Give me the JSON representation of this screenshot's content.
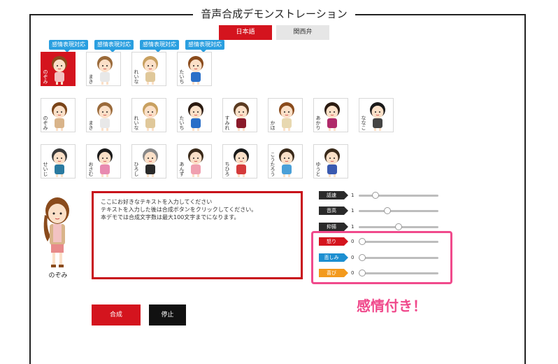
{
  "title": "音声合成デモンストレーション",
  "lang_tabs": [
    "日本語",
    "関西弁"
  ],
  "emotion_badge": "感情表現対応",
  "row1": [
    {
      "name": "のぞみ",
      "hair": "#8a4b1c",
      "shirt": "#f2c2c2"
    },
    {
      "name": "まき",
      "hair": "#9a6a3a",
      "shirt": "#e8e8e8"
    },
    {
      "name": "れいな",
      "hair": "#c8a060",
      "shirt": "#e0c89a"
    },
    {
      "name": "たいち",
      "hair": "#8a4b1c",
      "shirt": "#2a6fc8"
    }
  ],
  "row2": [
    {
      "name": "のぞみ",
      "hair": "#7a4418",
      "shirt": "#d9b48a"
    },
    {
      "name": "まき",
      "hair": "#9a6a3a",
      "shirt": "#e8e8e8"
    },
    {
      "name": "れいな",
      "hair": "#c8a060",
      "shirt": "#e0c89a"
    },
    {
      "name": "たいち",
      "hair": "#2a1a10",
      "shirt": "#2a6fc8"
    },
    {
      "name": "すみれ",
      "hair": "#5a3a20",
      "shirt": "#8a1a2a"
    },
    {
      "name": "かほ",
      "hair": "#8a4b1c",
      "shirt": "#e8d8b0"
    },
    {
      "name": "あかり",
      "hair": "#2a1a10",
      "shirt": "#b02a6a"
    },
    {
      "name": "ななこ",
      "hair": "#1a1a1a",
      "shirt": "#444444"
    }
  ],
  "row3": [
    {
      "name": "せいじ",
      "hair": "#3a3a3a",
      "shirt": "#2a7aa0"
    },
    {
      "name": "おさむ",
      "hair": "#1a1a1a",
      "shirt": "#e88ab0"
    },
    {
      "name": "ひろし",
      "hair": "#888888",
      "shirt": "#2a2a2a"
    },
    {
      "name": "あんず",
      "hair": "#3a2a1a",
      "shirt": "#f0a0b0"
    },
    {
      "name": "ちひろ",
      "hair": "#1a1a1a",
      "shirt": "#d43a3a"
    },
    {
      "name": "こうたろう",
      "hair": "#3a2a1a",
      "shirt": "#4aa0d8"
    },
    {
      "name": "ゆうと",
      "hair": "#3a2a1a",
      "shirt": "#3a5ab0"
    }
  ],
  "selected_character": "のぞみ",
  "text_input": "ここにお好きなテキストを入力してください\nテキストを入力した後は合成ボタンをクリックしてください。\n本デモでは合成文字数は最大100文字までになります。",
  "params": [
    {
      "label": "話速",
      "value": "1",
      "style": "dark",
      "level": 0.18
    },
    {
      "label": "音高",
      "value": "1",
      "style": "dark",
      "level": 0.35
    },
    {
      "label": "抑揚",
      "value": "1",
      "style": "dark",
      "level": 0.5
    },
    {
      "label": "怒り",
      "value": "0",
      "style": "red",
      "level": 0.0
    },
    {
      "label": "悲しみ",
      "value": "0",
      "style": "blue",
      "level": 0.0
    },
    {
      "label": "喜び",
      "value": "0",
      "style": "orange",
      "level": 0.0
    }
  ],
  "note": "感情付き！",
  "buttons": {
    "synth": "合成",
    "stop": "停止"
  }
}
